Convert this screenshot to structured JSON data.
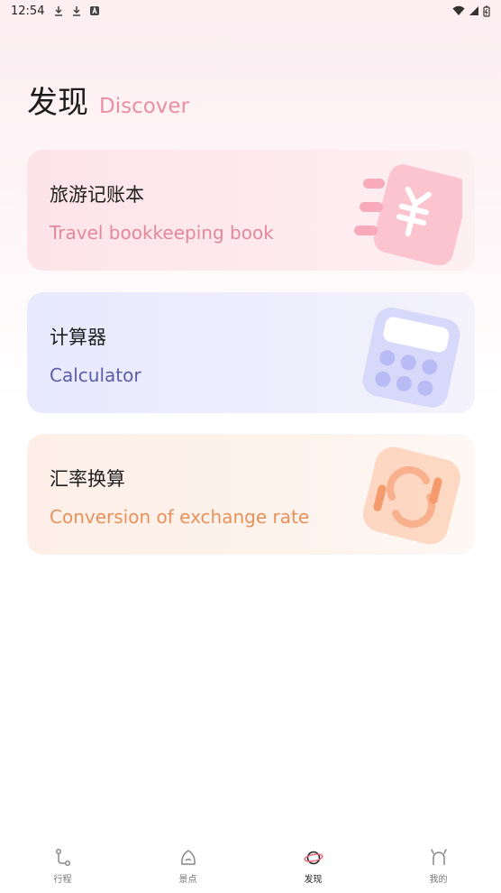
{
  "status_bar": {
    "time": "12:54",
    "icons_left": [
      "download-icon",
      "download-icon",
      "a-icon"
    ],
    "icons_right": [
      "wifi-icon",
      "signal-icon",
      "battery-icon"
    ]
  },
  "header": {
    "title": "发现",
    "subtitle": "Discover"
  },
  "cards": [
    {
      "title": "旅游记账本",
      "subtitle": "Travel bookkeeping book",
      "icon": "ledger-yen-icon",
      "accent": "#e3889b"
    },
    {
      "title": "计算器",
      "subtitle": "Calculator",
      "icon": "calculator-icon",
      "accent": "#5a5da8"
    },
    {
      "title": "汇率换算",
      "subtitle": "Conversion of exchange rate",
      "icon": "exchange-rate-icon",
      "accent": "#e8915b"
    }
  ],
  "tabbar": {
    "items": [
      {
        "label": "行程",
        "icon": "route-icon",
        "active": false
      },
      {
        "label": "景点",
        "icon": "attraction-icon",
        "active": false
      },
      {
        "label": "发现",
        "icon": "planet-icon",
        "active": true
      },
      {
        "label": "我的",
        "icon": "profile-icon",
        "active": false
      }
    ]
  }
}
